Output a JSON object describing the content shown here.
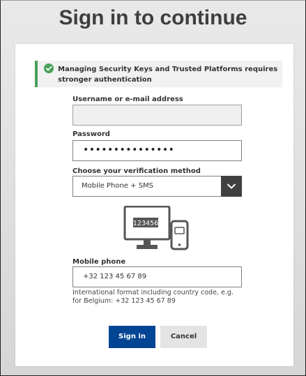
{
  "page": {
    "title": "Sign in to continue"
  },
  "alert": {
    "icon": "success-check-icon",
    "text": "Managing Security Keys and Trusted Platforms requires stronger authentication",
    "accent_color": "#49a05b"
  },
  "form": {
    "username_label": "Username or e-mail address",
    "username_value": "",
    "password_label": "Password",
    "password_value": "•••••••••••••••",
    "method_label": "Choose your verification method",
    "method_selected": "Mobile Phone + SMS",
    "illustration_code": "123456",
    "phone_label": "Mobile phone",
    "phone_value": "+32 123 45 67 89",
    "phone_hint": "International format including country code, e.g. for Belgium: +32 123 45 67 89"
  },
  "buttons": {
    "signin_label": "Sign in",
    "cancel_label": "Cancel",
    "primary_color": "#004494"
  }
}
